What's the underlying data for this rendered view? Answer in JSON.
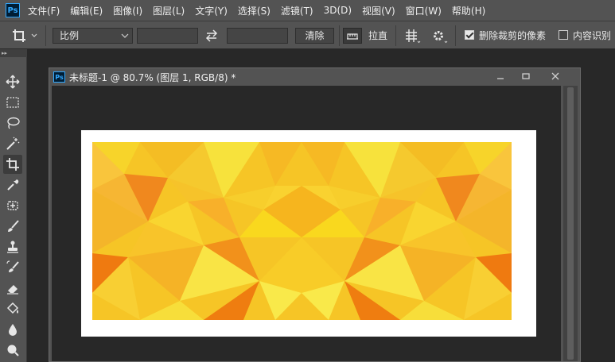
{
  "app": {
    "logo_text": "Ps"
  },
  "menu": [
    "文件(F)",
    "编辑(E)",
    "图像(I)",
    "图层(L)",
    "文字(Y)",
    "选择(S)",
    "滤镜(T)",
    "3D(D)",
    "视图(V)",
    "窗口(W)",
    "帮助(H)"
  ],
  "options": {
    "ratio_select": "比例",
    "ratio_chevron_icon": "chevron-down-icon",
    "width_value": "",
    "height_value": "",
    "clear_button": "清除",
    "straighten_label": "拉直",
    "delete_cropped_label": "删除裁剪的像素",
    "delete_cropped_checked": true,
    "content_aware_label": "内容识别",
    "content_aware_checked": false
  },
  "toolbar": {
    "collapse_glyph": "▸▸",
    "tools": [
      "move-icon",
      "marquee-icon",
      "lasso-icon",
      "magic-wand-icon",
      "crop-icon",
      "eyedropper-icon",
      "healing-brush-icon",
      "brush-icon",
      "clone-stamp-icon",
      "history-brush-icon",
      "eraser-icon",
      "paint-bucket-icon",
      "blur-icon",
      "dodge-icon"
    ],
    "active_tool": "crop-icon"
  },
  "document": {
    "logo_text": "Ps",
    "title": "未标题-1 @ 80.7% (图层 1, RGB/8) *",
    "controls": [
      "minimize-icon",
      "restore-icon",
      "close-icon"
    ]
  },
  "colors": {
    "ui_panel": "#535353",
    "workspace": "#282828",
    "accent": "#31a8ff",
    "art_yellow": "#f7d21a",
    "art_orange": "#ef8a12"
  }
}
